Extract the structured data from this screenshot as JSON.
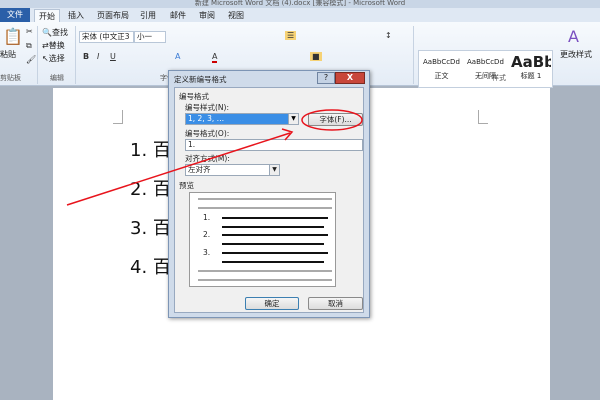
{
  "window": {
    "title": "新建 Microsoft Word 文档 (4).docx [兼容模式] - Microsoft Word"
  },
  "tabs": [
    {
      "label": "文件"
    },
    {
      "label": "开始"
    },
    {
      "label": "插入"
    },
    {
      "label": "页面布局"
    },
    {
      "label": "引用"
    },
    {
      "label": "邮件"
    },
    {
      "label": "审阅"
    },
    {
      "label": "视图"
    }
  ],
  "ribbon": {
    "clipboard": {
      "paste": "粘贴",
      "group": "剪贴板"
    },
    "editing": {
      "find": "查找",
      "replace": "替换",
      "select": "选择",
      "group": "编辑"
    },
    "font": {
      "name": "宋体 (中文正3",
      "size": "小一",
      "group": "字体"
    },
    "styles": {
      "items": [
        {
          "preview": "AaBbCcDd",
          "name": "正文"
        },
        {
          "preview": "AaBbCcDd",
          "name": "无间隔"
        },
        {
          "preview": "AaBb",
          "name": "标题 1"
        }
      ],
      "group": "样式",
      "change": "更改样式"
    }
  },
  "document": {
    "items": [
      "1. 百",
      "2. 百",
      "3. 百",
      "4. 百"
    ]
  },
  "dialog": {
    "title": "定义新编号格式",
    "help": "?",
    "close": "X",
    "section": "编号格式",
    "style_label": "编号样式(N):",
    "style_value": "1, 2, 3, …",
    "font_button": "字体(F)...",
    "format_label": "编号格式(O):",
    "format_value": "1.",
    "align_label": "对齐方式(M):",
    "align_value": "左对齐",
    "preview_label": "预览",
    "preview_numbers": [
      "1.",
      "2.",
      "3."
    ],
    "ok": "确定",
    "cancel": "取消"
  },
  "annotation": {
    "color": "#e8141c"
  }
}
